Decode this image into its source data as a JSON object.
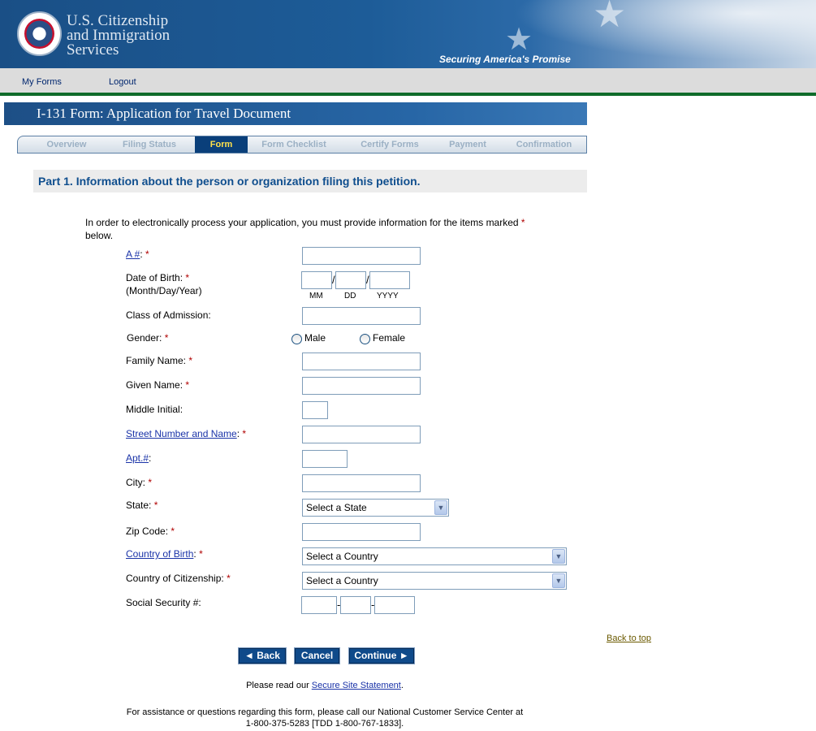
{
  "header": {
    "agency_line1": "U.S. Citizenship",
    "agency_line2": "and Immigration",
    "agency_line3": "Services",
    "tagline": "Securing America's Promise",
    "seal_icon": "dhs-seal-icon"
  },
  "topnav": {
    "my_forms": "My Forms",
    "logout": "Logout"
  },
  "form_title": "I-131 Form: Application for Travel Document",
  "steps": [
    {
      "label": "Overview"
    },
    {
      "label": "Filing Status"
    },
    {
      "label": "Form",
      "active": true
    },
    {
      "label": "Form Checklist"
    },
    {
      "label": "Certify Forms"
    },
    {
      "label": "Payment"
    },
    {
      "label": "Confirmation"
    }
  ],
  "part_header": "Part 1. Information about the person or organization filing this petition.",
  "instructions": {
    "text_before": "In order to electronically process your application, you must provide information for the items marked ",
    "asterisk": "*",
    "text_after": " below."
  },
  "fields": {
    "a_number": {
      "label": "A #",
      "sep": ":",
      "req": "*"
    },
    "dob": {
      "label": "Date of Birth:",
      "req": "*",
      "sub": "(Month/Day/Year)",
      "mm": "MM",
      "dd": "DD",
      "yyyy": "YYYY",
      "slash": "/"
    },
    "class_admission": {
      "label": "Class of Admission:"
    },
    "gender": {
      "label": "Gender:",
      "req": "*",
      "male": "Male",
      "female": "Female"
    },
    "family_name": {
      "label": "Family Name:",
      "req": "*"
    },
    "given_name": {
      "label": "Given Name:",
      "req": "*"
    },
    "middle_initial": {
      "label": "Middle Initial:"
    },
    "street": {
      "label": "Street Number and Name",
      "sep": ":",
      "req": "*"
    },
    "apt": {
      "label": "Apt.#",
      "sep": ":"
    },
    "city": {
      "label": "City:",
      "req": "*"
    },
    "state": {
      "label": "State:",
      "req": "*",
      "selected": "Select a State"
    },
    "zip": {
      "label": "Zip Code:",
      "req": "*"
    },
    "country_birth": {
      "label": "Country of Birth",
      "sep": ":",
      "req": "*",
      "selected": "Select a Country"
    },
    "country_citizenship": {
      "label": "Country of Citizenship:",
      "req": "*",
      "selected": "Select a Country"
    },
    "ssn": {
      "label": "Social Security #:",
      "dash": "-"
    }
  },
  "back_to_top": "Back to top",
  "buttons": {
    "back": "◄ Back",
    "cancel": "Cancel",
    "continue": "Continue ►"
  },
  "footer": {
    "secure_before": "Please read our ",
    "secure_link": "Secure Site Statement",
    "secure_after": ".",
    "assist_line1": "For assistance or questions regarding this form, please call our National Customer Service Center at",
    "assist_line2": "1-800-375-5283 [TDD 1-800-767-1833]."
  }
}
